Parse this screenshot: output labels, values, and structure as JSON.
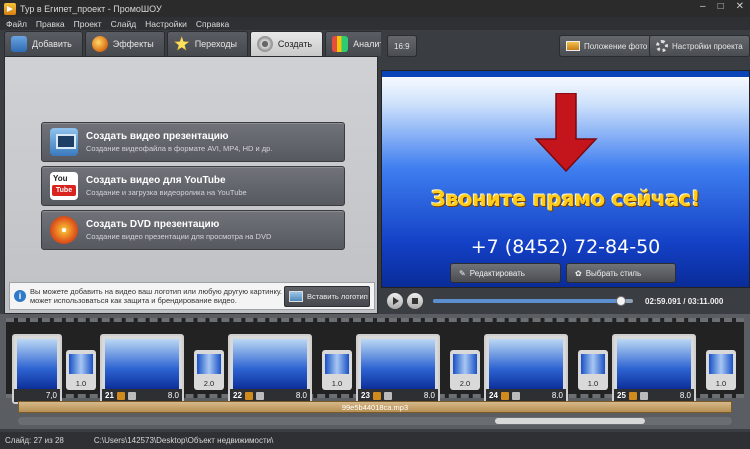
{
  "window": {
    "title": "Тур в Египет_проект - ПромоШОУ"
  },
  "menu": [
    "Файл",
    "Правка",
    "Проект",
    "Слайд",
    "Настройки",
    "Справка"
  ],
  "tabs": [
    {
      "label": "Добавить",
      "icon": "add-icon"
    },
    {
      "label": "Эффекты",
      "icon": "effects-icon"
    },
    {
      "label": "Переходы",
      "icon": "star-icon"
    },
    {
      "label": "Создать",
      "icon": "film-reel-icon"
    },
    {
      "label": "Аналитика",
      "icon": "analytics-icon"
    }
  ],
  "actions": [
    {
      "title": "Создать видео презентацию",
      "subtitle": "Создание видеофайла в формате AVI, MP4, HD и др."
    },
    {
      "title": "Создать видео для YouTube",
      "subtitle": "Создание и загрузка видеоролика на YouTube"
    },
    {
      "title": "Создать DVD презентацию",
      "subtitle": "Создание видео презентации для просмотра на DVD"
    }
  ],
  "info": {
    "text": "Вы можете добавить на видео ваш логотип или любую другую картинку. Это может использоваться как защита и брендирование видео.",
    "button": "Вставить логотип"
  },
  "preview_header": {
    "aspect": "16:9",
    "photo_position": "Положение фото",
    "project_settings": "Настройки проекта"
  },
  "preview": {
    "headline": "Звоните прямо сейчас!",
    "phone": "+7 (8452) 72-84-50",
    "edit_button": "Редактировать",
    "style_button": "Выбрать стиль"
  },
  "playback": {
    "time": "02:59.091 / 03:11.000",
    "progress": 0.94
  },
  "timeline": {
    "slides": [
      {
        "num": "",
        "duration": "7,0"
      },
      {
        "num": "21",
        "duration": "8.0"
      },
      {
        "num": "22",
        "duration": "8.0"
      },
      {
        "num": "23",
        "duration": "8.0"
      },
      {
        "num": "24",
        "duration": "8.0"
      },
      {
        "num": "25",
        "duration": "8.0"
      }
    ],
    "transitions": [
      "1.0",
      "2.0",
      "1.0",
      "2.0",
      "1.0",
      "1.0"
    ],
    "audio": "99e5b44018ca.mp3"
  },
  "status": {
    "slide": "Слайд: 27 из 28",
    "path": "C:\\Users\\142573\\Desktop\\Объект недвижимости\\"
  }
}
